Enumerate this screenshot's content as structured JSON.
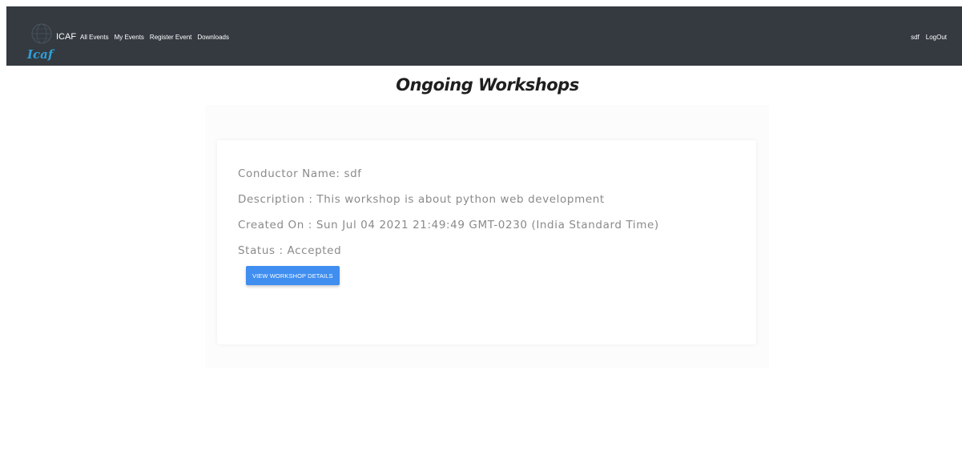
{
  "navbar": {
    "logo_text": "Icaf",
    "brand": "ICAF",
    "links": [
      "All Events",
      "My Events",
      "Register Event",
      "Downloads"
    ],
    "user": "sdf",
    "logout": "LogOut"
  },
  "page": {
    "title": "Ongoing Workshops"
  },
  "workshop": {
    "conductor": "Conductor Name: sdf",
    "description": "Description : This workshop is about python web development",
    "created_on": "Created On : Sun Jul 04 2021 21:49:49 GMT-0230 (India Standard Time)",
    "status": "Status : Accepted",
    "button_label": "VIEW WORKSHOP DETAILS"
  },
  "colors": {
    "navbar_bg": "#343a40",
    "button_bg": "#3f8ef0",
    "logo_accent": "#2f9fd8"
  }
}
